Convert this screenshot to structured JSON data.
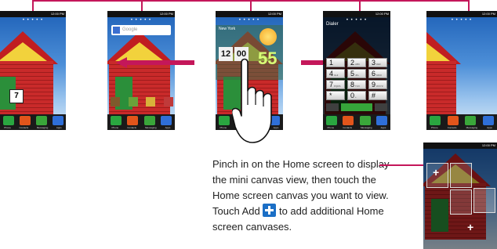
{
  "status": {
    "time": "12:00 PM"
  },
  "home_screen_indicator": "• • • • •",
  "dock": {
    "labels": [
      "Phone",
      "Contacts",
      "Messaging",
      "Apps"
    ],
    "colors": [
      "#2aa640",
      "#e2551b",
      "#3aa63a",
      "#2f6fd8"
    ]
  },
  "screens": {
    "first": {
      "calendar_number": "7"
    },
    "second": {
      "search_placeholder": "Google"
    },
    "third": {
      "clock_hour": "12",
      "clock_minute": "00",
      "temperature": "55",
      "location_line": "New York"
    },
    "fourth": {
      "app_title": "Dialer",
      "keys": [
        {
          "digit": "1",
          "letters": ""
        },
        {
          "digit": "2",
          "letters": "ABC"
        },
        {
          "digit": "3",
          "letters": "DEF"
        },
        {
          "digit": "4",
          "letters": "GHI"
        },
        {
          "digit": "5",
          "letters": "JKL"
        },
        {
          "digit": "6",
          "letters": "MNO"
        },
        {
          "digit": "7",
          "letters": "PQRS"
        },
        {
          "digit": "8",
          "letters": "TUV"
        },
        {
          "digit": "9",
          "letters": "WXYZ"
        },
        {
          "digit": "*",
          "letters": ""
        },
        {
          "digit": "0",
          "letters": "+"
        },
        {
          "digit": "#",
          "letters": ""
        }
      ]
    }
  },
  "instruction": {
    "part1": "Pinch in on the Home screen to display the mini canvas view, then touch the Home screen canvas you want to view. Touch ",
    "add_label": "Add",
    "part2": " to add additional Home screen canvases."
  },
  "colors": {
    "accent": "#c4175a",
    "add_button": "#1b6fc6"
  }
}
